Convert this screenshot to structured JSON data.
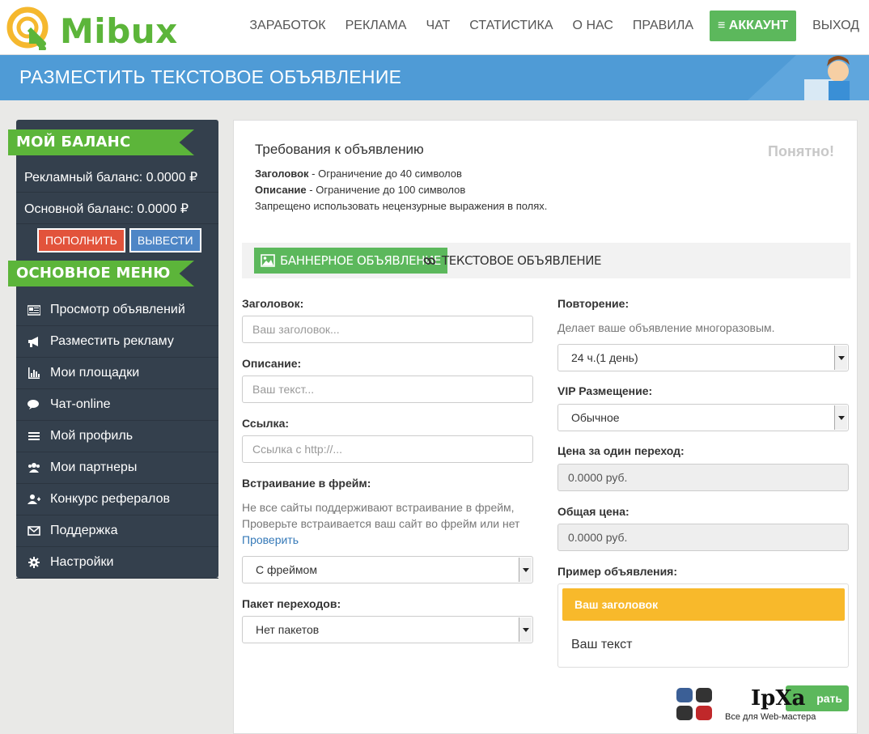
{
  "header": {
    "logo_text": "Mibux",
    "nav": [
      "ЗАРАБОТОК",
      "РЕКЛАМА",
      "ЧАТ",
      "СТАТИСТИКА",
      "О НАС",
      "ПРАВИЛА"
    ],
    "account_label": "АККАУНТ",
    "exit_label": "ВЫХОД"
  },
  "banner": {
    "title": "РАЗМЕСТИТЬ ТЕКСТОВОЕ ОБЪЯВЛЕНИЕ"
  },
  "sidebar": {
    "balance_heading": "МОЙ БАЛАНС",
    "ad_balance": "Рекламный баланс: 0.0000 ₽",
    "main_balance": "Основной баланс: 0.0000 ₽",
    "topup_label": "ПОПОЛНИТЬ",
    "withdraw_label": "ВЫВЕСТИ",
    "menu_heading": "ОСНОВНОЕ МЕНЮ",
    "menu": [
      {
        "label": "Просмотр объявлений",
        "icon": "newspaper-icon"
      },
      {
        "label": "Разместить рекламу",
        "icon": "megaphone-icon"
      },
      {
        "label": "Мои площадки",
        "icon": "bar-chart-icon"
      },
      {
        "label": "Чат-online",
        "icon": "chat-icon"
      },
      {
        "label": "Мой профиль",
        "icon": "list-icon"
      },
      {
        "label": "Мои партнеры",
        "icon": "users-icon"
      },
      {
        "label": "Конкурс рефералов",
        "icon": "user-plus-icon"
      },
      {
        "label": "Поддержка",
        "icon": "envelope-icon"
      },
      {
        "label": "Настройки",
        "icon": "gear-icon"
      }
    ]
  },
  "requirements": {
    "title": "Требования к объявлению",
    "header_bold": "Заголовок",
    "header_text": " - Ограничение до 40 символов",
    "desc_bold": "Описание",
    "desc_text": " - Ограничение до 100 символов",
    "note": "Запрещено использовать нецензурные выражения в полях.",
    "ok_label": "Понятно!"
  },
  "tabs": {
    "banner": "БАННЕРНОЕ ОБЪЯВЛЕНИЕ",
    "text": "ТЕКСТОВОЕ ОБЪЯВЛЕНИЕ"
  },
  "form": {
    "title_label": "Заголовок:",
    "title_placeholder": "Ваш заголовок...",
    "desc_label": "Описание:",
    "desc_placeholder": "Ваш текст...",
    "link_label": "Ссылка:",
    "link_placeholder": "Ссылка с http://...",
    "frame_label": "Встраивание в фрейм:",
    "frame_hint_1": "Не все сайты поддерживают встраивание в фрейм,",
    "frame_hint_2": "Проверьте встраивается ваш сайт во фрейм или нет",
    "frame_check": "Проверить",
    "frame_value": "С фреймом",
    "package_label": "Пакет переходов:",
    "package_value": "Нет пакетов",
    "repeat_label": "Повторение:",
    "repeat_hint": "Делает ваше объявление многоразовым.",
    "repeat_value": "24 ч.(1 день)",
    "vip_label": "VIP Размещение:",
    "vip_value": "Обычное",
    "price_label": "Цена за один переход:",
    "price_value": "0.0000 руб.",
    "total_label": "Общая цена:",
    "total_value": "0.0000 руб.",
    "example_label": "Пример объявления:",
    "example_title": "Ваш заголовок",
    "example_text": "Ваш текст",
    "submit_label": "рать"
  },
  "watermark": {
    "text": "IpXa",
    "sub": "Все для Web-мастера"
  },
  "colors": {
    "brand_green": "#5cb53a",
    "banner_blue": "#4f9bd6",
    "sidebar": "#34404d",
    "preview_yellow": "#f8b92b"
  }
}
